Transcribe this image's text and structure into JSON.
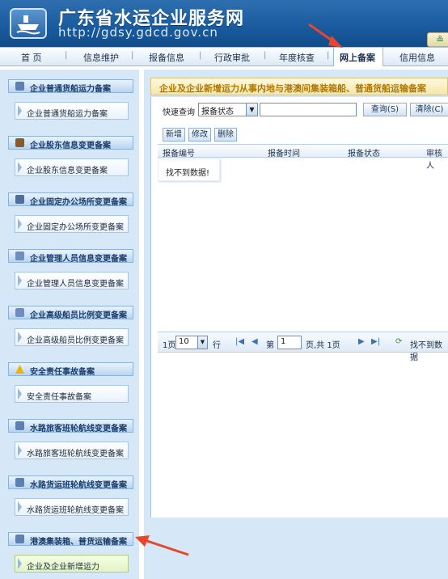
{
  "header": {
    "title": "广东省水运企业服务网",
    "url": "http://gdsy.gdcd.gov.cn",
    "right_button_glyph": "≗"
  },
  "nav": {
    "items": [
      "首 页",
      "信息维护",
      "报备信息",
      "行政审批",
      "年度核查",
      "网上备案",
      "信用信息"
    ],
    "separator": "|",
    "active": "网上备案"
  },
  "sidebar": {
    "groups": [
      {
        "title": "企业普通货船运力备案",
        "item": "企业普通货船运力备案",
        "icon": "user-icon"
      },
      {
        "title": "企业股东信息变更备案",
        "item": "企业股东信息变更备案",
        "icon": "user-icon"
      },
      {
        "title": "企业固定办公场所变更备案",
        "item": "企业固定办公场所变更备案",
        "icon": "building-icon"
      },
      {
        "title": "企业管理人员信息变更备案",
        "item": "企业管理人员信息变更备案",
        "icon": "card-icon"
      },
      {
        "title": "企业高级船员比例变更备案",
        "item": "企业高级船员比例变更备案",
        "icon": "card-icon"
      },
      {
        "title": "安全责任事故备案",
        "item": "安全责任事故备案",
        "icon": "warning-icon"
      },
      {
        "title": "水路旅客班轮航线变更备案",
        "item": "水路旅客班轮航线变更备案",
        "icon": "user-icon"
      },
      {
        "title": "水路货运班轮航线变更备案",
        "item": "水路货运班轮航线变更备案",
        "icon": "user-icon"
      },
      {
        "title": "港澳集装箱、普货运输备案",
        "item": "企业及企业新增运力",
        "icon": "user-icon"
      }
    ]
  },
  "panel": {
    "title": "企业及企业新增运力从事内地与港澳间集装箱船、普通货船运输备案",
    "search_label": "快速查询",
    "search_field": "报备状态",
    "search_value": "",
    "query_button": "查询(S)",
    "clear_button": "清除(C)",
    "toolbar": {
      "add": "新增",
      "edit": "修改",
      "delete": "删除"
    },
    "columns": [
      "报备编号",
      "报备时间",
      "报备状态",
      "审核人"
    ],
    "empty_message": "找不到数据!"
  },
  "pager": {
    "per_page_prefix": "1页",
    "page_size": "10",
    "rows_suffix": "行",
    "page_prefix": "第",
    "current_page": "1",
    "page_suffix": "页,共 1页",
    "status": "找不到数据"
  },
  "colors": {
    "header_blue": "#1a5c9f",
    "sidebar_bg": "#d6e7f7",
    "panel_title": "#b07800",
    "annotation_arrow": "#e8452c"
  }
}
